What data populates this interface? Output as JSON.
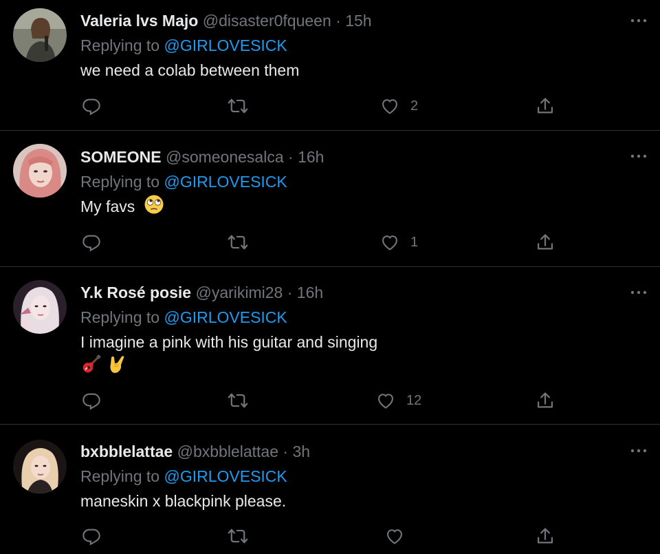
{
  "colors": {
    "background": "#000000",
    "text": "#e7e9ea",
    "muted": "#71767b",
    "accent": "#1d9bf0",
    "separator": "#2f3336"
  },
  "tweets": [
    {
      "name": "Valeria lvs Majo",
      "handle": "@disaster0fqueen",
      "dot": "·",
      "time": "15h",
      "replying_prefix": "Replying to ",
      "replying_to": "@GIRLOVESICK",
      "text": "we need a colab between them",
      "emoji_names": [],
      "likes": "2",
      "icons": [
        "reply-icon",
        "retweet-icon",
        "like-icon",
        "share-icon",
        "more-icon"
      ]
    },
    {
      "name": "SOMEONE",
      "handle": "@someonesalca",
      "dot": "·",
      "time": "16h",
      "replying_prefix": "Replying to ",
      "replying_to": "@GIRLOVESICK",
      "text": "My favs",
      "emoji_names": [
        "face-with-rolling-eyes"
      ],
      "likes": "1",
      "icons": [
        "reply-icon",
        "retweet-icon",
        "like-icon",
        "share-icon",
        "more-icon"
      ]
    },
    {
      "name": "Y.k Rosé posie",
      "handle": "@yarikimi28",
      "dot": "·",
      "time": "16h",
      "replying_prefix": "Replying to ",
      "replying_to": "@GIRLOVESICK",
      "text": "I imagine a pink with his guitar and singing",
      "emoji_names": [
        "guitar",
        "sign-of-the-horns"
      ],
      "likes": "12",
      "icons": [
        "reply-icon",
        "retweet-icon",
        "like-icon",
        "share-icon",
        "more-icon"
      ]
    },
    {
      "name": "bxbblelattae",
      "handle": "@bxbblelattae",
      "dot": "·",
      "time": "3h",
      "replying_prefix": "Replying to ",
      "replying_to": "@GIRLOVESICK",
      "text": "maneskin x blackpink please.",
      "emoji_names": [],
      "likes": "",
      "icons": [
        "reply-icon",
        "retweet-icon",
        "like-icon",
        "share-icon",
        "more-icon"
      ]
    }
  ]
}
